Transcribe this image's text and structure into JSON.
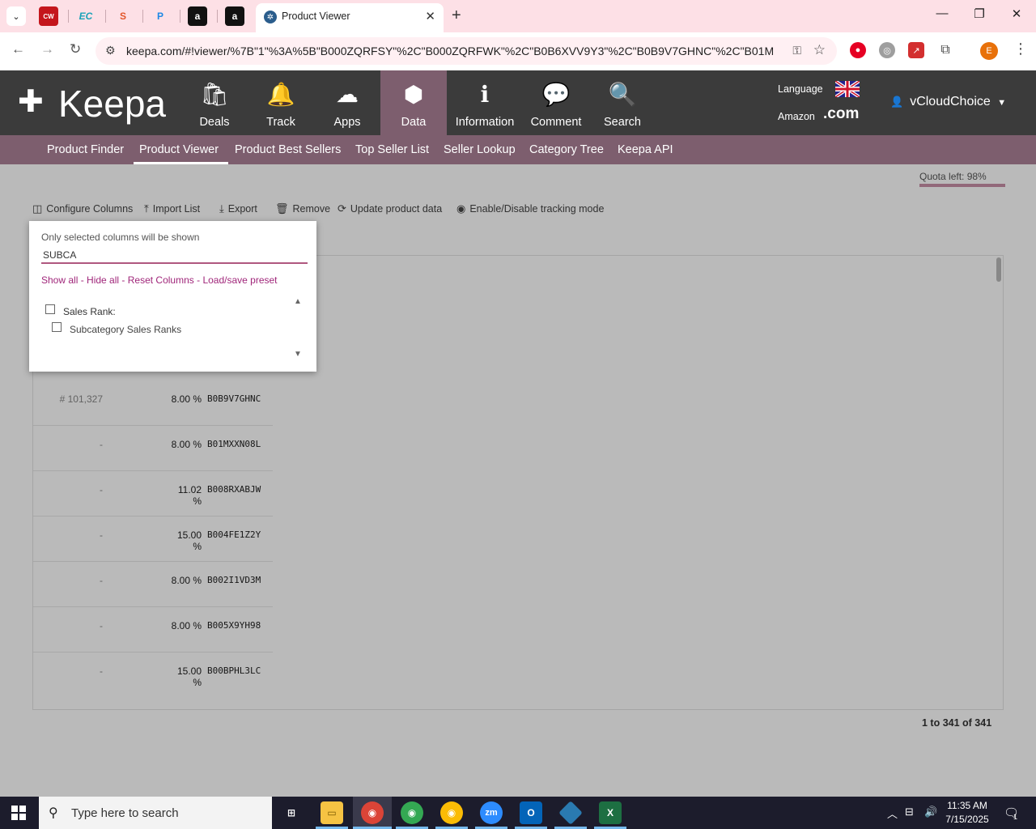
{
  "browser": {
    "active_tab_title": "Product Viewer",
    "new_tab_symbol": "+",
    "url": "keepa.com/#!viewer/%7B\"1\"%3A%5B\"B000ZQRFSY\"%2C\"B000ZQRFWK\"%2C\"B0B6XVV9Y3\"%2C\"B0B9V7GHNC\"%2C\"B01MXXN...",
    "profile_initial": "E",
    "pinned_tabs": [
      "CW",
      "EC",
      "S",
      "P",
      "a",
      "a"
    ]
  },
  "header": {
    "logo": "Keepa",
    "nav": [
      {
        "label": "Deals",
        "icon": "shopping-bag-icon"
      },
      {
        "label": "Track",
        "icon": "bell-icon"
      },
      {
        "label": "Apps",
        "icon": "cloud-download-icon"
      },
      {
        "label": "Data",
        "icon": "cube-icon"
      },
      {
        "label": "Information",
        "icon": "info-icon"
      },
      {
        "label": "Comment",
        "icon": "comments-icon"
      },
      {
        "label": "Search",
        "icon": "search-icon"
      }
    ],
    "language_label": "Language",
    "amazon_label": "Amazon",
    "domain": ".com",
    "username": "vCloudChoice"
  },
  "subnav": {
    "items": [
      "Product Finder",
      "Product Viewer",
      "Product Best Sellers",
      "Top Seller List",
      "Seller Lookup",
      "Category Tree",
      "Keepa API"
    ],
    "active": "Product Viewer"
  },
  "quota": "Quota left: 98%",
  "actions": [
    "Configure Columns",
    "Import List",
    "Export",
    "Remove",
    "Update product data",
    "Enable/Disable tracking mode"
  ],
  "column_popup": {
    "hint": "Only selected columns will be shown",
    "search_value": "SUBCA",
    "links": [
      "Show all",
      "Hide all",
      "Reset Columns",
      "Load/save preset"
    ],
    "group_label": "Sales Rank:",
    "option_label": "Subcategory Sales Ranks"
  },
  "rows": [
    {
      "rank": "# 101,327",
      "pct": "8.00 %",
      "asin": "B0B9V7GHNC"
    },
    {
      "rank": "-",
      "pct": "8.00 %",
      "asin": "B01MXXN08L"
    },
    {
      "rank": "-",
      "pct": "11.02 %",
      "asin": "B008RXABJW"
    },
    {
      "rank": "-",
      "pct": "15.00 %",
      "asin": "B004FE1Z2Y"
    },
    {
      "rank": "-",
      "pct": "8.00 %",
      "asin": "B002I1VD3M"
    },
    {
      "rank": "-",
      "pct": "8.00 %",
      "asin": "B005X9YH98"
    },
    {
      "rank": "-",
      "pct": "15.00 %",
      "asin": "B00BPHL3LC"
    }
  ],
  "pager": "1 to 341 of 341",
  "taskbar": {
    "search_placeholder": "Type here to search",
    "time": "11:35 AM",
    "date": "7/15/2025",
    "notification_count": "1"
  }
}
